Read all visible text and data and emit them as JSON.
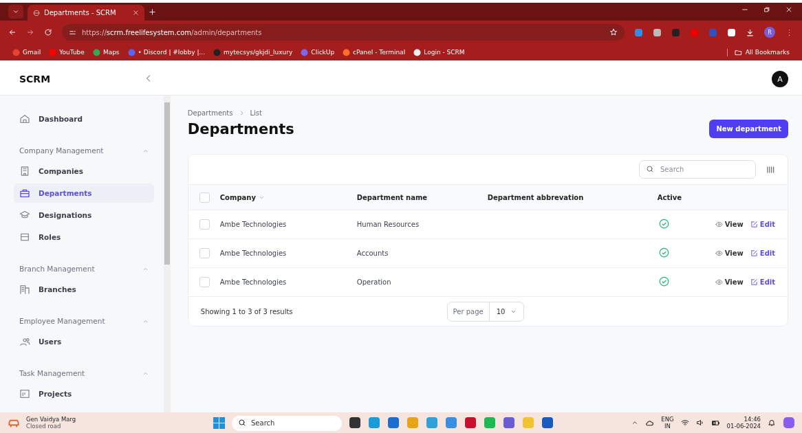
{
  "browser": {
    "tab_title": "Departments - SCRM",
    "url": {
      "scheme": "https://",
      "host": "scrm.freelifesystem.com",
      "path": "/admin/departments"
    },
    "bookmarks": [
      "Gmail",
      "YouTube",
      "Maps",
      "• Discord | #lobby |...",
      "mytecsys/gkjdi_luxury",
      "ClickUp",
      "cPanel - Terminal",
      "Login - SCRM"
    ],
    "all_bookmarks": "All Bookmarks",
    "profile": "R"
  },
  "app": {
    "brand": "SCRM",
    "avatar": "A",
    "sidebar": [
      {
        "kind": "item",
        "label": "Dashboard",
        "selected": false
      },
      {
        "kind": "group",
        "label": "Company Management",
        "expanded": true,
        "children": [
          {
            "label": "Companies",
            "selected": false
          },
          {
            "label": "Departments",
            "selected": true
          },
          {
            "label": "Designations",
            "selected": false
          },
          {
            "label": "Roles",
            "selected": false
          }
        ]
      },
      {
        "kind": "group",
        "label": "Branch Management",
        "expanded": true,
        "children": [
          {
            "label": "Branches",
            "selected": false
          }
        ]
      },
      {
        "kind": "group",
        "label": "Employee Management",
        "expanded": true,
        "children": [
          {
            "label": "Users",
            "selected": false
          }
        ]
      },
      {
        "kind": "group",
        "label": "Task Management",
        "expanded": true,
        "children": [
          {
            "label": "Projects",
            "selected": false
          }
        ]
      }
    ],
    "breadcrumbs": [
      "Departments",
      "List"
    ],
    "title": "Departments",
    "new_button": "New department",
    "search": {
      "placeholder": "Search"
    },
    "table": {
      "select_all_checked": false,
      "columns": [
        "Company",
        "Department name",
        "Department abbrevation",
        "Active"
      ],
      "rows": [
        {
          "checked": false,
          "company": "Ambe Technologies",
          "name": "Human Resources",
          "active": true,
          "view": "View",
          "edit": "Edit"
        },
        {
          "checked": false,
          "company": "Ambe Technologies",
          "name": "Accounts",
          "active": true,
          "view": "View",
          "edit": "Edit"
        },
        {
          "checked": false,
          "company": "Ambe Technologies",
          "name": "Operation",
          "active": true,
          "view": "View",
          "edit": "Edit"
        }
      ],
      "summary": "Showing 1 to 3 of 3 results",
      "per_page_label": "Per page",
      "per_page": "10"
    }
  },
  "taskbar": {
    "weather_title": "Gen Vaidya Marg",
    "weather_sub": "Closed road",
    "search": {
      "placeholder": "Search"
    },
    "lang": "ENG",
    "region": "IN",
    "time": "14:46",
    "date": "01-06-2024"
  }
}
